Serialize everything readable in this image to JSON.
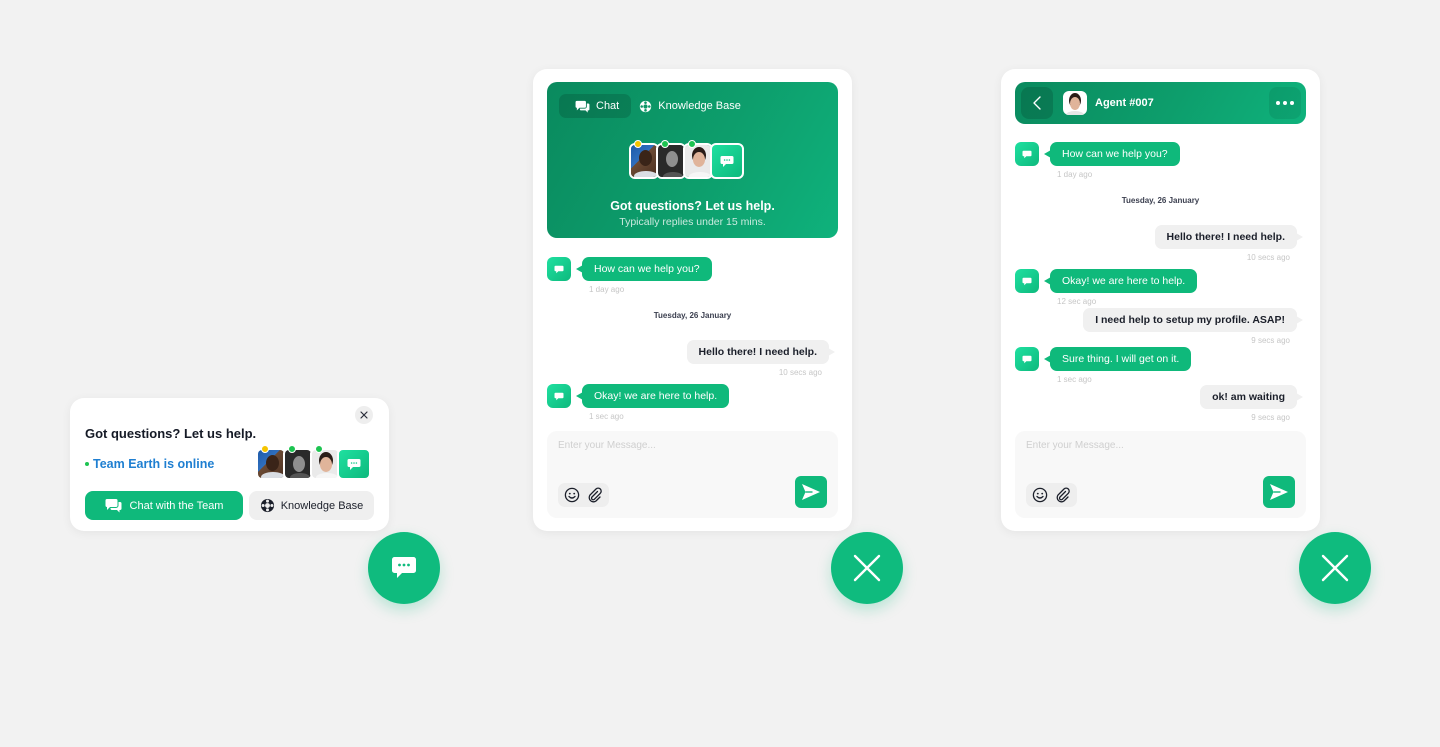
{
  "colors": {
    "brand": "#0fb97b",
    "brand_dark": "#0a8a5e",
    "online_text": "#1f7fd1",
    "online_dot": "#1dc451",
    "status_away": "#f5c400",
    "status_online": "#1dc451"
  },
  "mini_widget": {
    "title": "Got questions? Let us help.",
    "online_status": "Team Earth is online",
    "close_icon": "close-icon",
    "agents": [
      {
        "name": "agent-1",
        "status": "away"
      },
      {
        "name": "agent-2",
        "status": "online"
      },
      {
        "name": "agent-3",
        "status": "online"
      }
    ],
    "chat_button_label": "Chat with the Team",
    "kb_button_label": "Knowledge Base",
    "fab_icon": "chat-bubble-icon"
  },
  "chat_widget": {
    "tabs": [
      {
        "label": "Chat",
        "icon": "chat-bubbles-icon",
        "active": true
      },
      {
        "label": "Knowledge Base",
        "icon": "lifebuoy-icon",
        "active": false
      }
    ],
    "hero_title": "Got questions? Let us help.",
    "hero_subtitle": "Typically replies under 15 mins.",
    "messages": [
      {
        "direction": "in",
        "text": "How can we help you?",
        "time": "1 day ago"
      },
      {
        "direction": "out",
        "text": "Hello there! I need help.",
        "time": "10 secs ago"
      },
      {
        "direction": "in",
        "text": "Okay! we are here to help.",
        "time": "1 sec ago"
      }
    ],
    "date_separator": "Tuesday, 26 January",
    "composer": {
      "placeholder": "Enter your Message...",
      "value": ""
    },
    "fab_icon": "close-icon"
  },
  "agent_widget": {
    "agent_name": "Agent #007",
    "back_icon": "chevron-left-icon",
    "more_icon": "more-horizontal-icon",
    "messages": [
      {
        "direction": "in",
        "text": "How can we help you?",
        "time": "1 day ago"
      },
      {
        "direction": "out",
        "text": "Hello there! I need help.",
        "time": "10 secs ago"
      },
      {
        "direction": "in",
        "text": "Okay! we are here to help.",
        "time": "12 sec ago"
      },
      {
        "direction": "out",
        "text": "I need help to setup my profile. ASAP!",
        "time": "9 secs ago"
      },
      {
        "direction": "in",
        "text": "Sure thing. I will get on it.",
        "time": "1 sec ago"
      },
      {
        "direction": "out",
        "text": "ok! am waiting",
        "time": "9 secs ago"
      }
    ],
    "date_separator": "Tuesday, 26 January",
    "composer": {
      "placeholder": "Enter your Message...",
      "value": ""
    },
    "fab_icon": "close-icon"
  }
}
